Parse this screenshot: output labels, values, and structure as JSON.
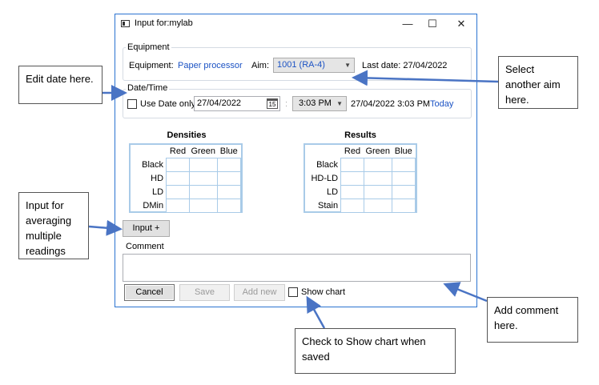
{
  "window": {
    "title": "Input for:mylab",
    "minimize": "—",
    "maximize": "☐",
    "close": "✕"
  },
  "equipment": {
    "group_label": "Equipment",
    "equipment_label": "Equipment:",
    "equipment_value": "Paper processor",
    "aim_label": "Aim:",
    "aim_value": "1001 (RA-4)",
    "last_date": "Last date: 27/04/2022"
  },
  "datetime": {
    "group_label": "Date/Time",
    "use_date_only": "Use Date only",
    "date_value": "27/04/2022",
    "calendar_day": "15",
    "time_value": "3:03 PM",
    "combined": "27/04/2022 3:03 PM",
    "today_link": "Today"
  },
  "densities": {
    "title": "Densities",
    "columns": [
      "Red",
      "Green",
      "Blue"
    ],
    "rows": [
      "Black",
      "HD",
      "LD",
      "DMin"
    ]
  },
  "results": {
    "title": "Results",
    "columns": [
      "Red",
      "Green",
      "Blue"
    ],
    "rows": [
      "Black",
      "HD-LD",
      "LD",
      "Stain"
    ]
  },
  "input_plus": "Input +",
  "comment": {
    "label": "Comment",
    "value": ""
  },
  "buttons": {
    "cancel": "Cancel",
    "save": "Save",
    "add_new": "Add new",
    "show_chart": "Show chart"
  },
  "callouts": {
    "edit_date": "Edit date here.",
    "select_aim": "Select another aim here.",
    "input_averaging": "Input for averaging multiple readings",
    "add_comment": "Add comment here.",
    "show_chart_hint": "Check to Show chart when saved"
  },
  "colors": {
    "window_border": "#2b73d1",
    "link": "#1c53c4",
    "grid_border": "#a9cbe8",
    "arrow": "#4a74c4"
  },
  "icons": {
    "calendar": "calendar-icon",
    "combo_arrow": "chevron-down-icon"
  }
}
